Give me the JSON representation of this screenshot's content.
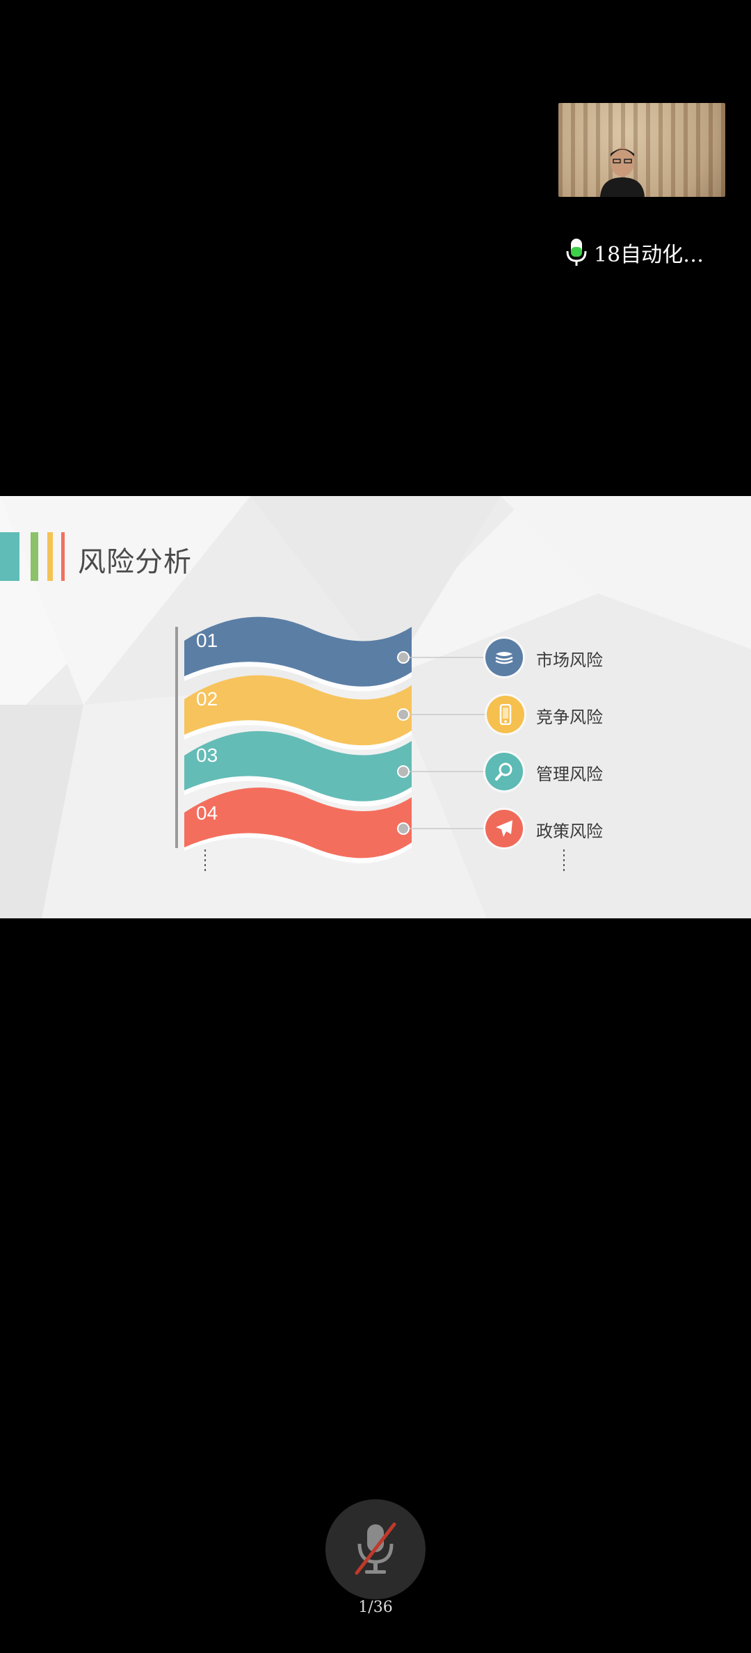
{
  "participant": {
    "name": "18自动化…"
  },
  "slide": {
    "title": "风险分析",
    "accent_colors": [
      "#5fbcb7",
      "#8bc26a",
      "#f5c354",
      "#f2705f"
    ],
    "ribbons": [
      {
        "num": "01",
        "color": "#5b7ea5",
        "risk": "市场风险",
        "icon": "layers-icon",
        "icon_color": "#5b7ea5"
      },
      {
        "num": "02",
        "color": "#f7c35c",
        "risk": "竞争风险",
        "icon": "phone-icon",
        "icon_color": "#f6c04f"
      },
      {
        "num": "03",
        "color": "#64bcb6",
        "risk": "管理风险",
        "icon": "search-icon",
        "icon_color": "#5dbab4"
      },
      {
        "num": "04",
        "color": "#f46e5d",
        "risk": "政策风险",
        "icon": "airplane-icon",
        "icon_color": "#f06a5a"
      }
    ]
  },
  "controls": {
    "page_counter": "1/36",
    "mic_state": "muted"
  }
}
